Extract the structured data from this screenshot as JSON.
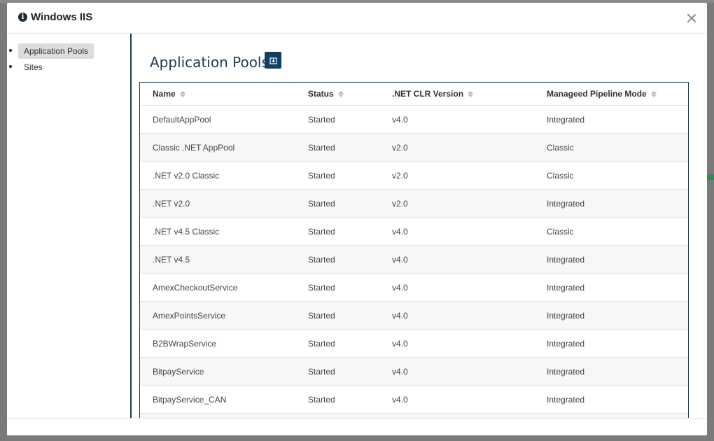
{
  "dialog": {
    "title": "Windows IIS"
  },
  "sidebar": {
    "items": [
      {
        "label": "Application Pools",
        "active": true
      },
      {
        "label": "Sites",
        "active": false
      }
    ]
  },
  "main": {
    "heading": "Application Pools",
    "export_icon": "export-icon"
  },
  "table": {
    "columns": [
      "Name",
      "Status",
      ".NET CLR Version",
      "Manageed Pipeline Mode"
    ],
    "rows": [
      [
        "DefaultAppPool",
        "Started",
        "v4.0",
        "Integrated"
      ],
      [
        "Classic .NET AppPool",
        "Started",
        "v2.0",
        "Classic"
      ],
      [
        ".NET v2.0 Classic",
        "Started",
        "v2.0",
        "Classic"
      ],
      [
        ".NET v2.0",
        "Started",
        "v2.0",
        "Integrated"
      ],
      [
        ".NET v4.5 Classic",
        "Started",
        "v4.0",
        "Classic"
      ],
      [
        ".NET v4.5",
        "Started",
        "v4.0",
        "Integrated"
      ],
      [
        "AmexCheckoutService",
        "Started",
        "v4.0",
        "Integrated"
      ],
      [
        "AmexPointsService",
        "Started",
        "v4.0",
        "Integrated"
      ],
      [
        "B2BWrapService",
        "Started",
        "v4.0",
        "Integrated"
      ],
      [
        "BitpayService",
        "Started",
        "v4.0",
        "Integrated"
      ],
      [
        "BitpayService_CAN",
        "Started",
        "v4.0",
        "Integrated"
      ],
      [
        "",
        "",
        "",
        ""
      ]
    ]
  },
  "colors": {
    "accent": "#0f3f62",
    "border": "#1f3a50"
  }
}
